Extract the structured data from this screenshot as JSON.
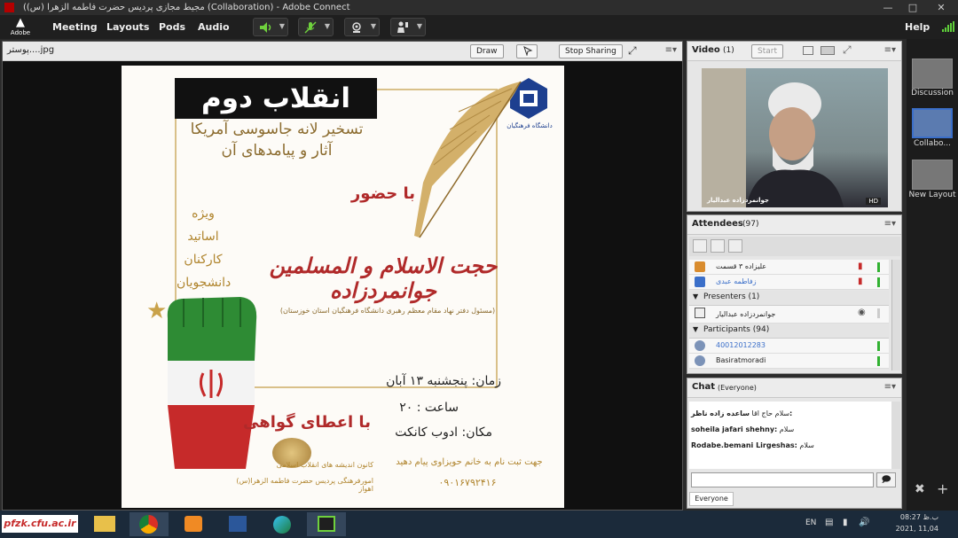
{
  "window": {
    "title": "(مجیط مجازی پردیس حضرت فاطمه الزهرا (س) (Collaboration) - Adobe Connect"
  },
  "menubar": {
    "logo_mark": "Adobe",
    "items": [
      "Meeting",
      "Layouts",
      "Pods",
      "Audio"
    ],
    "help": "Help"
  },
  "share_pod": {
    "filename": "پوستر....jpg",
    "draw_label": "Draw",
    "stop_label": "Stop Sharing"
  },
  "poster": {
    "headline": "انقلاب دوم",
    "subtitle_1": "تسخیر لانه جاسوسی آمریکا",
    "subtitle_2": "آثار و پیامدهای آن",
    "with_presence": "با حضور",
    "speaker": "حجت الاسلام و المسلمین جوانمردزاده",
    "speaker_role": "(مسئول دفتر نهاد مقام معظم رهبری دانشگاه فرهنگیان استان خوزستان)",
    "audience": [
      "ویژه",
      "اساتید",
      "کارکنان",
      "دانشجویان"
    ],
    "when": "زمان: پنجشنبه ۱۳ آبان",
    "hour": "ساعت : ۲۰",
    "place": "مکان: ادوب کانکت",
    "certificate": "با اعطای گواهی",
    "register": "جهت ثبت نام به خانم حویزاوی پیام دهید",
    "phone": "۰۹۰۱۶۷۹۲۴۱۶",
    "org_1": "کانون اندیشه های انقلاب اسلامی",
    "org_2": "امورفرهنگی پردیس حضرت فاطمه الزهرا(س) اهواز",
    "uni_logo_text": "دانشگاه فرهنگیان"
  },
  "video_pod": {
    "title": "Video",
    "count": "(1)",
    "start_label": "Start",
    "caption": "جوانمردزاده عبدالیار",
    "hd": "HD"
  },
  "attendees_pod": {
    "title": "Attendees",
    "count": "(97)",
    "hosts": [
      "علیزاده ۳ قسمت",
      "زفاطمه عبدی"
    ],
    "presenters_label": "Presenters (1)",
    "presenters": [
      "جوانمردزاده عبدالیار"
    ],
    "participants_label": "Participants (94)",
    "participants": [
      "40012012283",
      "Basiratmoradi"
    ]
  },
  "chat_pod": {
    "title": "Chat",
    "scope": "(Everyone)",
    "messages": [
      {
        "sender": "سلام حاج اقا",
        "text": "ساعده زاده ناظر:"
      },
      {
        "sender": "soheila jafari shehny:",
        "text": "سلام"
      },
      {
        "sender": "Rodabe.bemani Lirgeshas:",
        "text": "سلام"
      }
    ],
    "recipient": "Everyone"
  },
  "layouts": [
    "Discussion",
    "Collabo...",
    "New Layout"
  ],
  "taskbar": {
    "watermark": "pfzk.cfu.ac.ir",
    "lang": "EN",
    "time": "08:27 ب.ظ",
    "date": "2021, 11,04"
  },
  "colors": {
    "green_fist": "#2e8b34",
    "flag_red": "#c62a2a",
    "gold": "#c9a24a",
    "accent_blue": "#3b6fc9"
  }
}
